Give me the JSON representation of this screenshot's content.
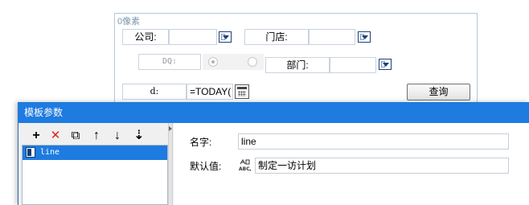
{
  "form": {
    "watermark": "0像素",
    "company_label": "公司:",
    "store_label": "门店:",
    "dq_label": "DQ:",
    "dept_label": "部门:",
    "d_label": "d:",
    "formula": "=TODAY(",
    "query_button": "查询"
  },
  "dialog": {
    "title": "模板参数",
    "toolbar": {
      "add_glyph": "+",
      "delete_glyph": "✕",
      "copy_glyph": "⧉",
      "up_glyph": "↑",
      "down_glyph": "↓",
      "sort_glyph": "⇣"
    },
    "tree": {
      "items": [
        "line"
      ]
    },
    "fields": {
      "name_label": "名字:",
      "name_value": "line",
      "default_label": "默认值:",
      "default_value": "制定一访计划"
    }
  },
  "colors": {
    "title_bar": "#1e7be0",
    "selection": "#1e7be0",
    "delete_icon": "#e0241b",
    "dropdown_border": "#1f3f73"
  },
  "icons": [
    "dropdown-icon",
    "calendar-icon",
    "add-icon",
    "delete-icon",
    "copy-icon",
    "move-up-icon",
    "move-down-icon",
    "sort-icon",
    "parameter-icon",
    "abc-type-icon"
  ]
}
